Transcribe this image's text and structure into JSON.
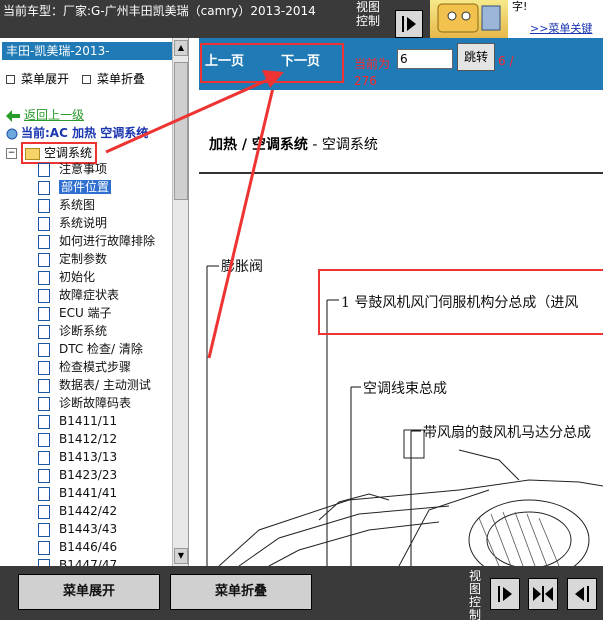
{
  "header": {
    "car_title": "当前车型：厂家:G-广州丰田凯美瑞（camry）2013-2014",
    "view_control": "视图控制",
    "ad_text": "字!",
    "ad_link": ">>菜单关键"
  },
  "left": {
    "title": "丰田-凯美瑞-2013-",
    "expand_label": "菜单展开",
    "collapse_label": "菜单折叠",
    "back_label": "返回上一级",
    "current_label": "当前:AC 加热 空调系统",
    "folder_label": "空调系统",
    "items": [
      "注意事项",
      "部件位置",
      "系统图",
      "系统说明",
      "如何进行故障排除",
      "定制参数",
      "初始化",
      "故障症状表",
      "ECU 端子",
      "诊断系统",
      "DTC 检查/ 清除",
      "检查模式步骤",
      "数据表/ 主动测试",
      "诊断故障码表",
      "B1411/11",
      "B1412/12",
      "B1413/13",
      "B1423/23",
      "B1441/41",
      "B1442/42",
      "B1443/43",
      "B1446/46",
      "B1447/47"
    ]
  },
  "nav": {
    "prev_label": "上一页",
    "next_label": "下一页",
    "current_label": "当前为",
    "page_value": "6",
    "jump_label": "跳转",
    "page_count_a": "6 /",
    "page_count_b": "276"
  },
  "doc": {
    "heading_bold": "加热 / 空调系统",
    "heading_rest": " - 空调系统",
    "callout_1": "膨胀阀",
    "callout_2": "1 号鼓风机风门伺服机构分总成（进风",
    "callout_3": "空调线束总成",
    "callout_4": "带风扇的鼓风机马达分总成"
  },
  "bottom": {
    "expand_label": "菜单展开",
    "collapse_label": "菜单折叠",
    "view_control": "视图控制"
  },
  "colors": {
    "accent_blue": "#1f7ab5",
    "highlight_red": "#ee3333",
    "toolbar_dark": "#3a3a3a"
  }
}
